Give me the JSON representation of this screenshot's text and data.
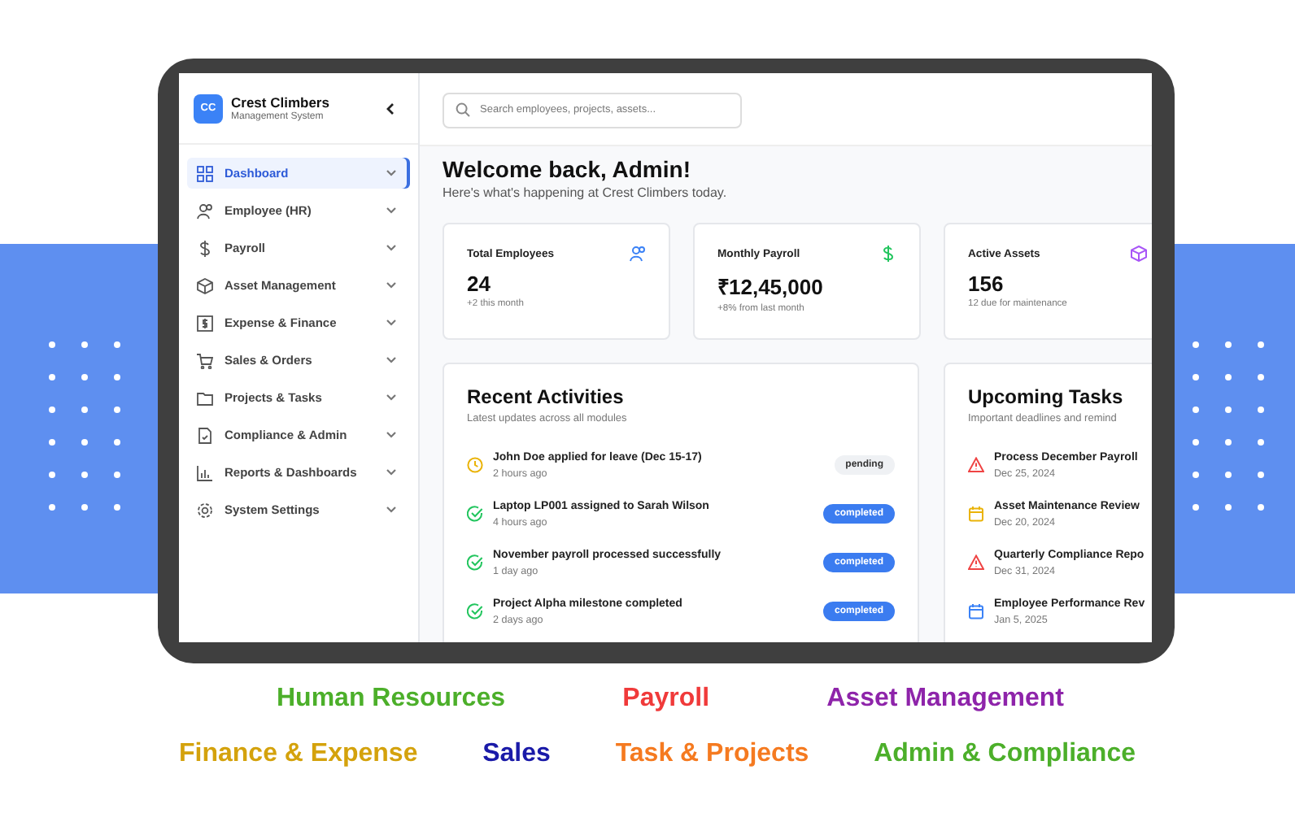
{
  "sidebar": {
    "brand": {
      "logo": "CC",
      "title": "Crest Climbers",
      "subtitle": "Management System"
    },
    "items": [
      {
        "label": "Dashboard",
        "selected": true
      },
      {
        "label": "Employee (HR)",
        "selected": false
      },
      {
        "label": "Payroll",
        "selected": false
      },
      {
        "label": "Asset Management",
        "selected": false
      },
      {
        "label": "Expense & Finance",
        "selected": false
      },
      {
        "label": "Sales & Orders",
        "selected": false
      },
      {
        "label": "Projects & Tasks",
        "selected": false
      },
      {
        "label": "Compliance & Admin",
        "selected": false
      },
      {
        "label": "Reports & Dashboards",
        "selected": false
      },
      {
        "label": "System Settings",
        "selected": false
      }
    ]
  },
  "search": {
    "placeholder": "Search employees, projects, assets..."
  },
  "welcome": {
    "title": "Welcome back, Admin!",
    "subtitle": "Here's what's happening at Crest Climbers today."
  },
  "stats": [
    {
      "title": "Total Employees",
      "value": "24",
      "note": "+2 this month",
      "kind": "people",
      "color": "#3b82f6"
    },
    {
      "title": "Monthly Payroll",
      "value": "₹12,45,000",
      "note": "+8% from last month",
      "kind": "dollar",
      "color": "#22c55e"
    },
    {
      "title": "Active Assets",
      "value": "156",
      "note": "12 due for maintenance",
      "kind": "box",
      "color": "#a855f7"
    }
  ],
  "activities": {
    "title": "Recent Activities",
    "subtitle": "Latest updates across all modules",
    "items": [
      {
        "text": "John Doe applied for leave (Dec 15-17)",
        "time": "2 hours ago",
        "kind": "pending",
        "status": "pending"
      },
      {
        "text": "Laptop LP001 assigned to Sarah Wilson",
        "time": "4 hours ago",
        "kind": "completed",
        "status": "completed"
      },
      {
        "text": "November payroll processed successfully",
        "time": "1 day ago",
        "kind": "completed",
        "status": "completed"
      },
      {
        "text": "Project Alpha milestone completed",
        "time": "2 days ago",
        "kind": "completed",
        "status": "completed"
      }
    ]
  },
  "tasks": {
    "title": "Upcoming Tasks",
    "subtitle": "Important deadlines and remind",
    "items": [
      {
        "text": "Process December Payroll",
        "date": "Dec 25, 2024",
        "kind": "alert",
        "color": "#ef4444"
      },
      {
        "text": "Asset Maintenance Review",
        "date": "Dec 20, 2024",
        "kind": "calendar",
        "color": "#eab308"
      },
      {
        "text": "Quarterly Compliance Repo",
        "date": "Dec 31, 2024",
        "kind": "alert",
        "color": "#ef4444"
      },
      {
        "text": "Employee Performance Rev",
        "date": "Jan 5, 2025",
        "kind": "calendar",
        "color": "#3b82f6"
      }
    ]
  },
  "label_rows": [
    {
      "items": [
        {
          "text": "Human Resources",
          "color": "#4caf2a"
        },
        {
          "text": "Payroll",
          "color": "#f03a3a"
        },
        {
          "text": "Asset Management",
          "color": "#8e24aa"
        }
      ]
    },
    {
      "items": [
        {
          "text": "Finance & Expense",
          "color": "#d4a20c"
        },
        {
          "text": "Sales",
          "color": "#1a1aa8"
        },
        {
          "text": "Task & Projects",
          "color": "#f57a20"
        },
        {
          "text": "Admin & Compliance",
          "color": "#4caf2a"
        }
      ]
    }
  ]
}
